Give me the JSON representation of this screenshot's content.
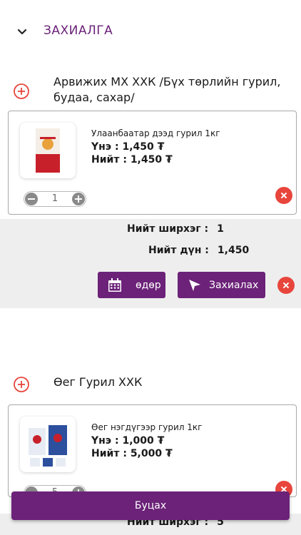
{
  "header": {
    "title": "ЗАХИАЛГА",
    "back_icon": "chevron-down-icon"
  },
  "orders": [
    {
      "vendor": "Арвижих МХ ХХК /Бүх төрлийн гурил, будаа, сахар/",
      "product": {
        "name": "Улаанбаатар дээд гурил 1кг",
        "price_label": "Үнэ :",
        "price": "1,450 ₮",
        "total_label": "Нийт :",
        "total": "1,450  ₮",
        "quantity": "1"
      },
      "summary": {
        "count_label": "Нийт ширхэг :",
        "count": "1",
        "sum_label": "Нийт дүн :",
        "sum": "1,450",
        "date_button": "өдөр",
        "order_button": "Захиалах"
      }
    },
    {
      "vendor": "Өег Гурил ХХК",
      "product": {
        "name": "Өег нэгдүгээр гурил 1кг",
        "price_label": "Үнэ :",
        "price": "1,000 ₮",
        "total_label": "Нийт :",
        "total": "5,000  ₮",
        "quantity": "5"
      },
      "summary": {
        "count_label": "Нийт ширхэг :",
        "count": "5"
      }
    }
  ],
  "footer": {
    "back_button": "Буцах"
  },
  "colors": {
    "accent": "#6b2278",
    "remove": "#e8453c",
    "add": "#e8453c"
  }
}
